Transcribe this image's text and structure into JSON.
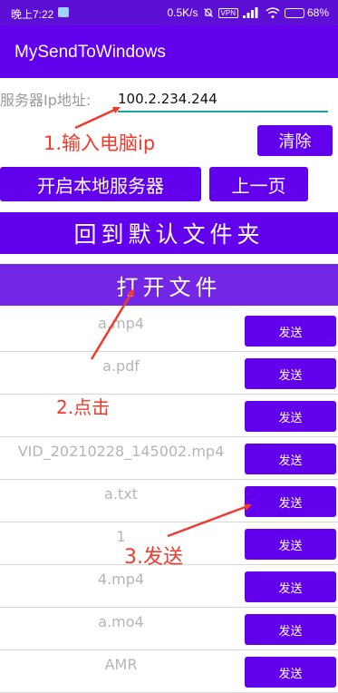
{
  "status_bar": {
    "time": "晚上7:22",
    "network_speed": "0.5K/s",
    "vpn_label": "VPN",
    "battery": "68%"
  },
  "app_bar": {
    "title": "MySendToWindows"
  },
  "server_ip": {
    "label": "服务器Ip地址:",
    "value": "100.2.234.244"
  },
  "buttons": {
    "clear": "清除",
    "start_server": "开启本地服务器",
    "previous_page": "上一页",
    "default_folder": "回到默认文件夹",
    "open_file": "打开文件"
  },
  "files": [
    {
      "name": "a.mp4",
      "action": "发送"
    },
    {
      "name": "a.pdf",
      "action": "发送"
    },
    {
      "name": "",
      "action": "发送"
    },
    {
      "name": "VID_20210228_145002.mp4",
      "action": "发送"
    },
    {
      "name": "a.txt",
      "action": "发送"
    },
    {
      "name": "1",
      "action": "发送"
    },
    {
      "name": "4.mp4",
      "action": "发送"
    },
    {
      "name": "a.mo4",
      "action": "发送"
    },
    {
      "name": "AMR",
      "action": "发送"
    }
  ],
  "annotations": {
    "step1": "1.输入电脑ip",
    "step2": "2.点击",
    "step3": "3.发送",
    "color": "#f2392b"
  },
  "colors": {
    "primary": "#6200ee",
    "status_bar": "#5d0fd6",
    "input_underline": "#19a6a3"
  }
}
